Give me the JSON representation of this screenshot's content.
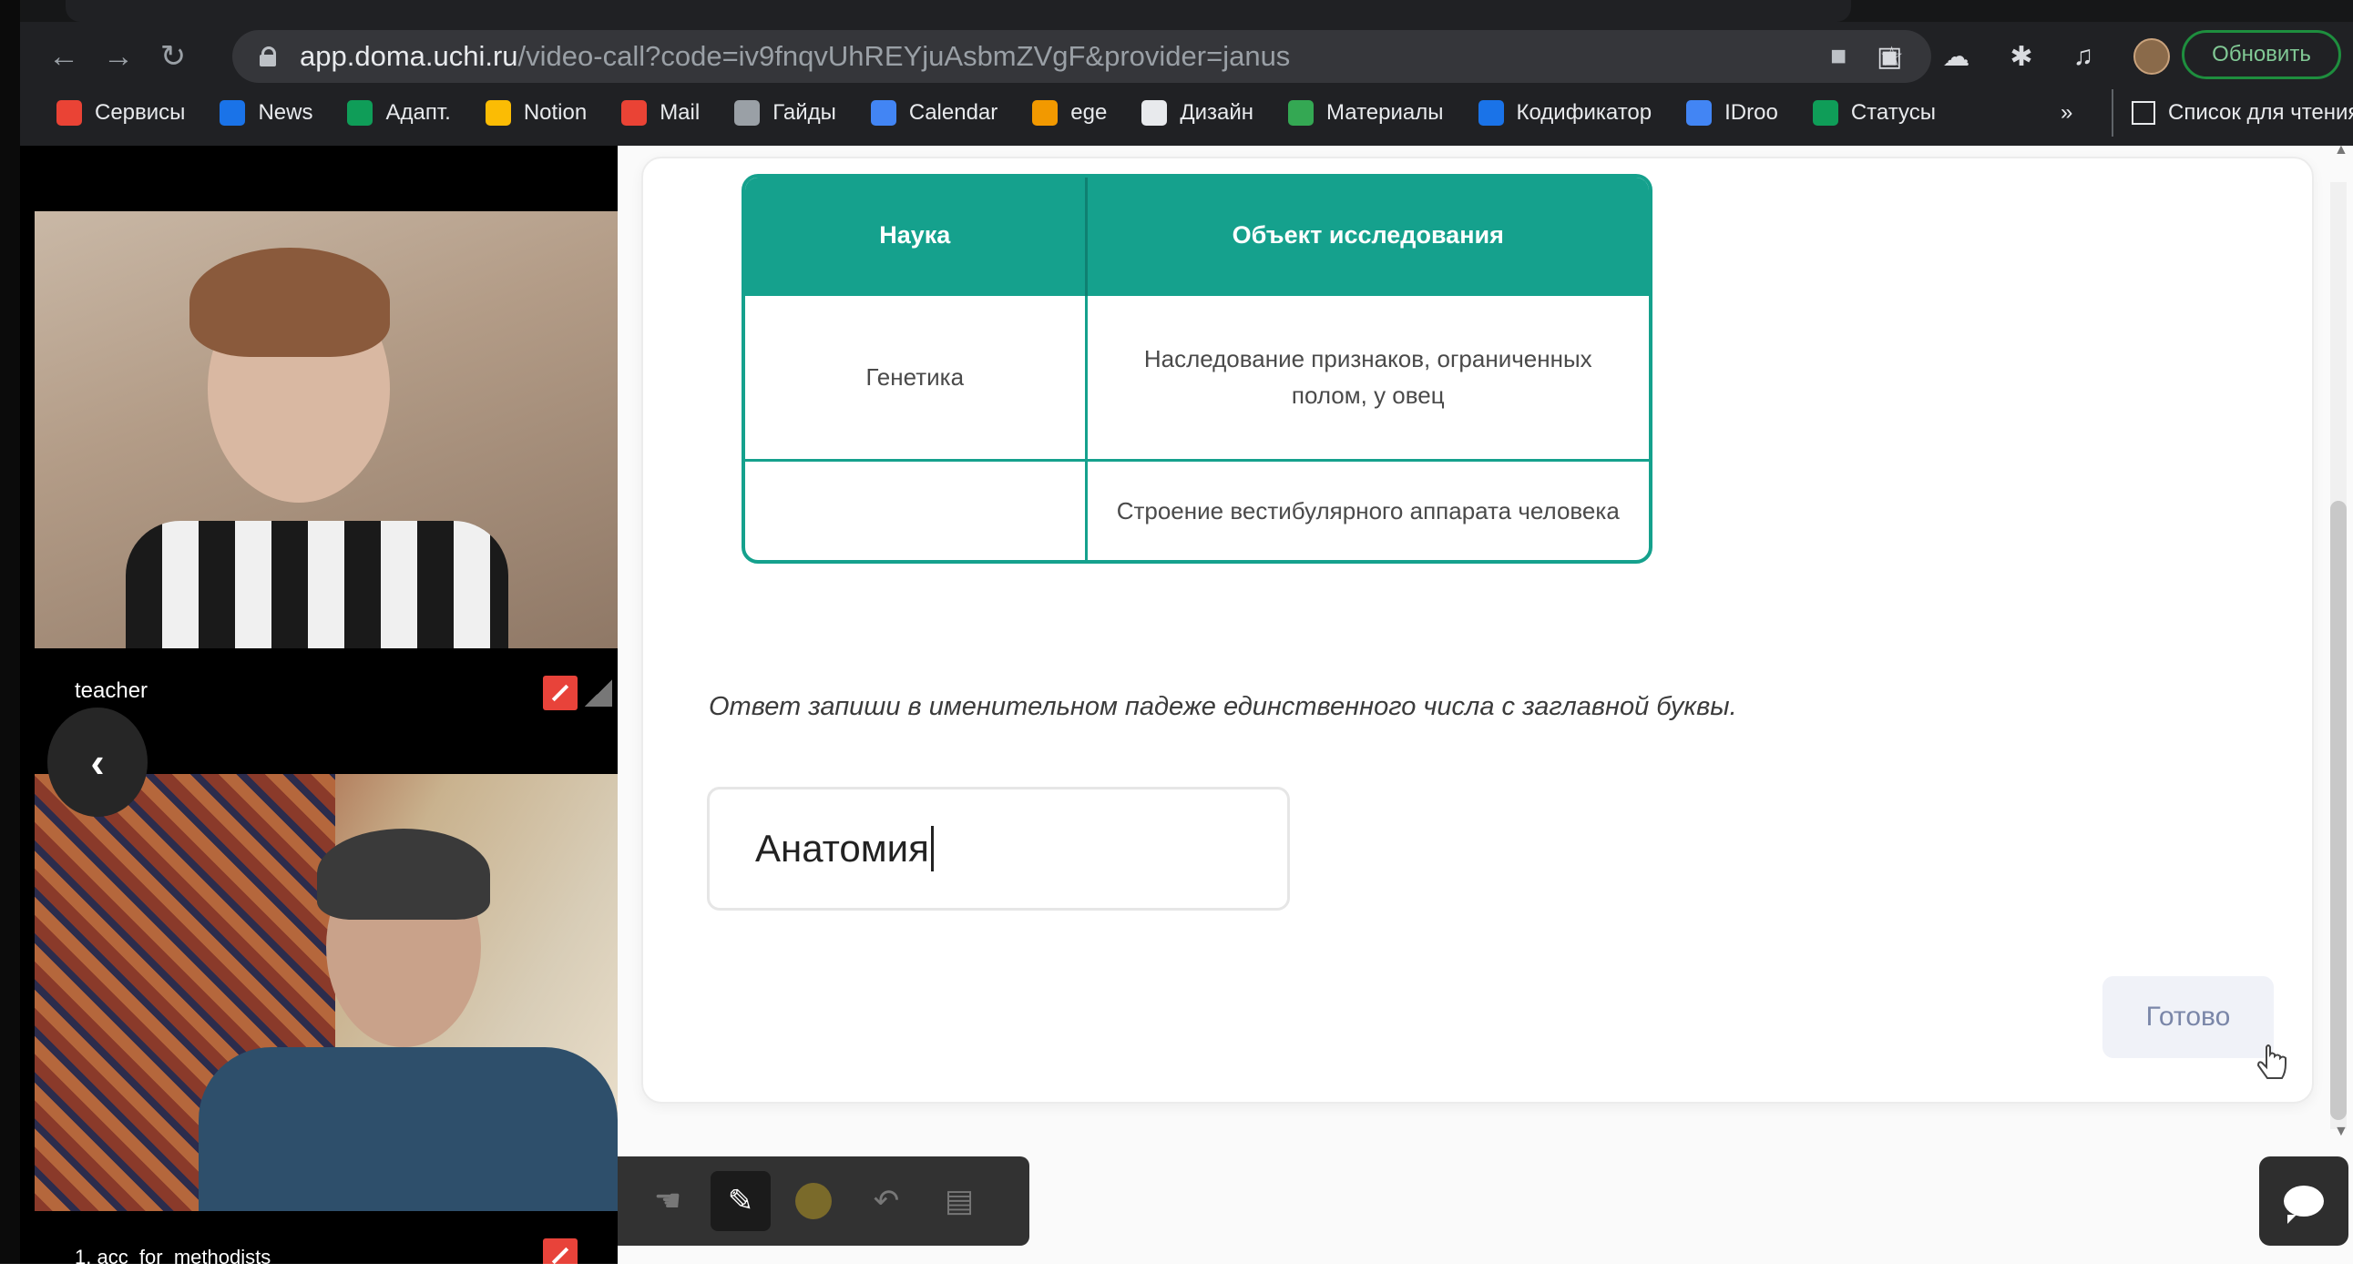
{
  "browser": {
    "url_host": "app.doma.uchi.ru",
    "url_path": "/video-call?code=iv9fnqvUhREYjuAsbmZVgF&provider=janus",
    "update_label": "Обновить",
    "bookmarks": [
      {
        "label": "Сервисы",
        "color": "#ea4335"
      },
      {
        "label": "News",
        "color": "#1a73e8"
      },
      {
        "label": "Адапт.",
        "color": "#0f9d58"
      },
      {
        "label": "Notion",
        "color": "#fbbc04"
      },
      {
        "label": "Mail",
        "color": "#ea4335"
      },
      {
        "label": "Гайды",
        "color": "#9aa0a6"
      },
      {
        "label": "Calendar",
        "color": "#4285f4"
      },
      {
        "label": "ege",
        "color": "#f29900"
      },
      {
        "label": "Дизайн",
        "color": "#e8eaed"
      },
      {
        "label": "Материалы",
        "color": "#34a853"
      },
      {
        "label": "Кодификатор",
        "color": "#1a73e8"
      },
      {
        "label": "IDroo",
        "color": "#4285f4"
      },
      {
        "label": "Статусы",
        "color": "#0f9d58"
      }
    ],
    "more_bookmarks": "»",
    "reading_list": "Список для чтения"
  },
  "participants": [
    {
      "name": "teacher"
    },
    {
      "name": "1. acc_for_methodists"
    }
  ],
  "table": {
    "headers": [
      "Наука",
      "Объект исследования"
    ],
    "rows": [
      [
        "Генетика",
        "Наследование признаков, ограниченных полом, у овец"
      ],
      [
        "",
        "Строение вестибулярного аппарата человека"
      ]
    ]
  },
  "task": {
    "instruction": "Ответ запиши в именительном падеже единственного числа с заглавной буквы.",
    "answer_value": "Анатомия",
    "submit_label": "Готово"
  },
  "toolbar": {
    "tools": [
      "hand-icon",
      "pen-icon",
      "color-picker",
      "undo-icon",
      "save-icon"
    ]
  },
  "colors": {
    "accent": "#15a18d",
    "toolbar_bg": "#323232",
    "done_text": "#7a86a8"
  }
}
